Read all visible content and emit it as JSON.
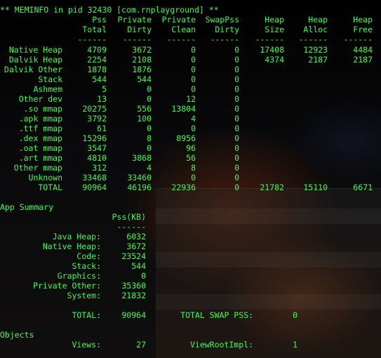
{
  "header": "** MEMINFO in pid 32430 [com.rnplayground] **",
  "columns": [
    {
      "top": "Pss",
      "bottom": "Total"
    },
    {
      "top": "Private",
      "bottom": "Dirty"
    },
    {
      "top": "Private",
      "bottom": "Clean"
    },
    {
      "top": "SwapPss",
      "bottom": "Dirty"
    },
    {
      "top": "Heap",
      "bottom": "Size"
    },
    {
      "top": "Heap",
      "bottom": "Alloc"
    },
    {
      "top": "Heap",
      "bottom": "Free"
    }
  ],
  "separator": "------",
  "rows": [
    {
      "label": "Native Heap",
      "values": [
        "4709",
        "3672",
        "0",
        "0",
        "17408",
        "12923",
        "4484"
      ]
    },
    {
      "label": "Dalvik Heap",
      "values": [
        "2254",
        "2108",
        "0",
        "0",
        "4374",
        "2187",
        "2187"
      ]
    },
    {
      "label": "Dalvik Other",
      "values": [
        "1878",
        "1876",
        "0",
        "0",
        "",
        "",
        ""
      ]
    },
    {
      "label": "Stack",
      "values": [
        "544",
        "544",
        "0",
        "0",
        "",
        "",
        ""
      ]
    },
    {
      "label": "Ashmem",
      "values": [
        "5",
        "0",
        "0",
        "0",
        "",
        "",
        ""
      ]
    },
    {
      "label": "Other dev",
      "values": [
        "13",
        "0",
        "12",
        "0",
        "",
        "",
        ""
      ]
    },
    {
      "label": ".so mmap",
      "values": [
        "20275",
        "556",
        "13804",
        "0",
        "",
        "",
        ""
      ]
    },
    {
      "label": ".apk mmap",
      "values": [
        "3792",
        "100",
        "4",
        "0",
        "",
        "",
        ""
      ]
    },
    {
      "label": ".ttf mmap",
      "values": [
        "61",
        "0",
        "0",
        "0",
        "",
        "",
        ""
      ]
    },
    {
      "label": ".dex mmap",
      "values": [
        "15296",
        "8",
        "8956",
        "0",
        "",
        "",
        ""
      ]
    },
    {
      "label": ".oat mmap",
      "values": [
        "3547",
        "0",
        "96",
        "0",
        "",
        "",
        ""
      ]
    },
    {
      "label": ".art mmap",
      "values": [
        "4810",
        "3868",
        "56",
        "0",
        "",
        "",
        ""
      ]
    },
    {
      "label": "Other mmap",
      "values": [
        "312",
        "4",
        "8",
        "0",
        "",
        "",
        ""
      ]
    },
    {
      "label": "Unknown",
      "values": [
        "33468",
        "33460",
        "0",
        "0",
        "",
        "",
        ""
      ]
    },
    {
      "label": "TOTAL",
      "values": [
        "90964",
        "46196",
        "22936",
        "0",
        "21782",
        "15110",
        "6671"
      ]
    }
  ],
  "app_summary": {
    "title": "App Summary",
    "column_header": "Pss(KB)",
    "separator": "------",
    "items": [
      {
        "label": "Java Heap:",
        "value": "6032"
      },
      {
        "label": "Native Heap:",
        "value": "3672"
      },
      {
        "label": "Code:",
        "value": "23524"
      },
      {
        "label": "Stack:",
        "value": "544"
      },
      {
        "label": "Graphics:",
        "value": "0"
      },
      {
        "label": "Private Other:",
        "value": "35360"
      },
      {
        "label": "System:",
        "value": "21832"
      }
    ],
    "total_label": "TOTAL:",
    "total_value": "90964",
    "swap_label": "TOTAL SWAP PSS:",
    "swap_value": "0"
  },
  "objects": {
    "title": "Objects",
    "views_label": "Views:",
    "views_value": "27",
    "viewroot_label": "ViewRootImpl:",
    "viewroot_value": "1"
  }
}
